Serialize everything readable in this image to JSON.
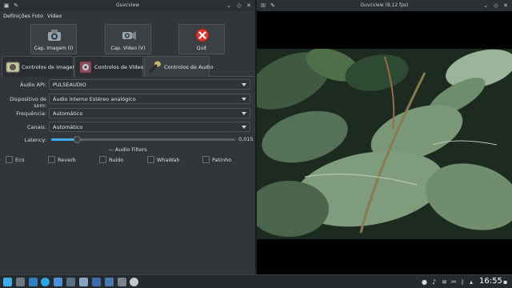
{
  "left_window": {
    "title": "Guvcview",
    "menu": [
      "Definições",
      "Foto",
      "Vídeo"
    ],
    "big_buttons": [
      {
        "label": "Cap. Imagem (I)",
        "icon": "camera-icon"
      },
      {
        "label": "Cap. Vídeo (V)",
        "icon": "video-camera-icon"
      },
      {
        "label": "Quit",
        "icon": "quit-icon",
        "color": "#d63a2f"
      }
    ],
    "tabs": [
      {
        "label": "Controlos de imagem",
        "icon": "image-controls-icon"
      },
      {
        "label": "Controlos de Vídeo",
        "icon": "video-controls-icon"
      },
      {
        "label": "Controlos de Audio",
        "icon": "microphone-icon"
      }
    ],
    "active_tab": 2,
    "fields": {
      "audio_api": {
        "label": "Áudio API:",
        "value": "PULSEAUDIO"
      },
      "device": {
        "label": "Dispositivo de som:",
        "value": "Áudio interno Estéreo analógico"
      },
      "frequency": {
        "label": "Frequência:",
        "value": "Automático"
      },
      "channels": {
        "label": "Canais:",
        "value": "Automático"
      }
    },
    "latency": {
      "label": "Latency:",
      "value": "0,015",
      "level": 0.14
    },
    "filters_title": "Audio Filters",
    "filters": [
      "Eco",
      "Reverb",
      "Ruído",
      "WhaWah",
      "Patinho"
    ]
  },
  "right_window": {
    "title": "Guvcview (8,12 fps)"
  },
  "taskbar": {
    "clock": "16:55",
    "accent": "#3daee9"
  }
}
